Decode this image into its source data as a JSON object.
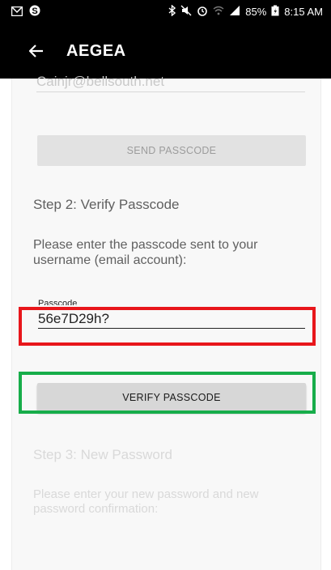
{
  "status_bar": {
    "battery": "85%",
    "time": "8:15 AM",
    "icons": [
      "mail-icon",
      "skype-icon",
      "bluetooth-icon",
      "mute-icon",
      "alarm-icon",
      "wifi-icon",
      "signal-icon",
      "battery-icon"
    ]
  },
  "app_bar": {
    "title": "AEGEA"
  },
  "step1": {
    "email_value": "Cainjr@bellsouth.net",
    "send_button_label": "SEND PASSCODE"
  },
  "step2": {
    "heading": "Step 2: Verify Passcode",
    "description": "Please enter the passcode sent to your username (email account):",
    "passcode_label": "Passcode",
    "passcode_value": "56e7D29h?",
    "verify_button_label": "VERIFY PASSCODE"
  },
  "step3": {
    "heading": "Step 3: New Password",
    "description": "Please enter your new password and new password confirmation:"
  },
  "colors": {
    "app_bar": "#000000",
    "highlight_red": "#e8161b",
    "highlight_green": "#17ad4a"
  }
}
